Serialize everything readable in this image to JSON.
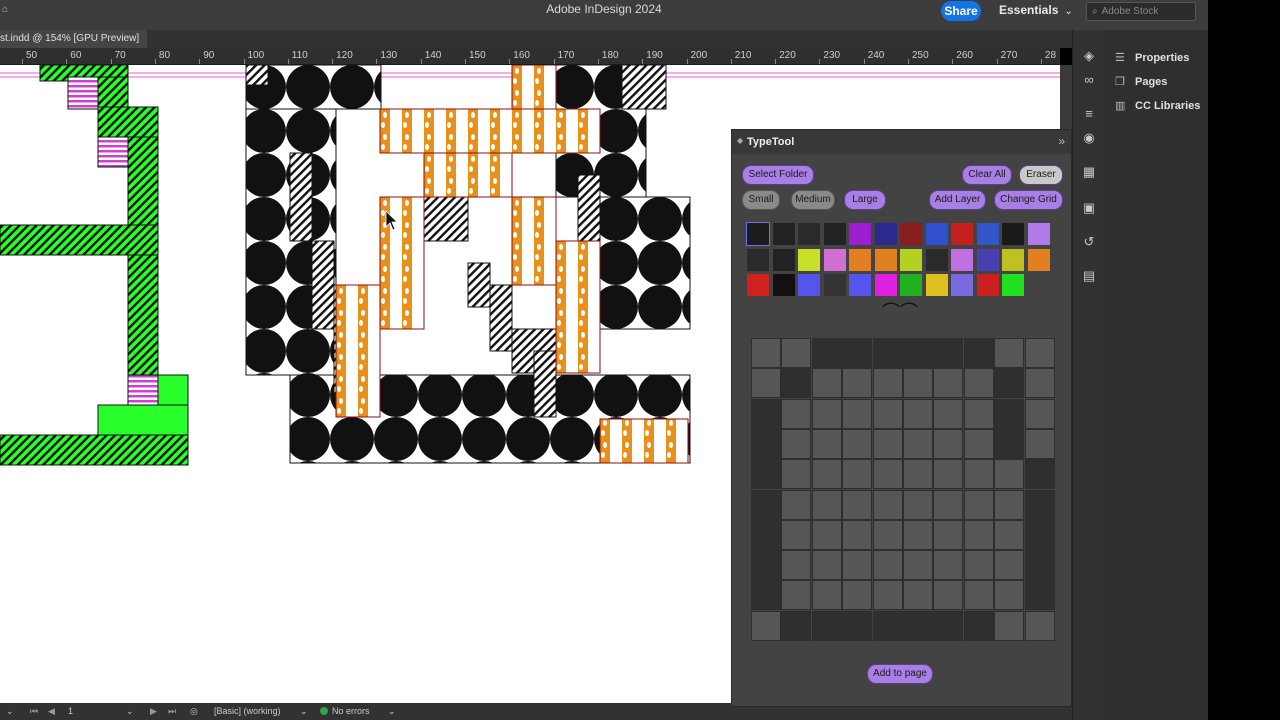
{
  "app": {
    "title": "Adobe InDesign 2024",
    "share_label": "Share",
    "workspace": "Essentials",
    "stock_placeholder": "Adobe Stock"
  },
  "document": {
    "tab_label": "st.indd @ 154% [GPU Preview]"
  },
  "ruler": {
    "labels": [
      "50",
      "60",
      "70",
      "80",
      "90",
      "100",
      "110",
      "120",
      "130",
      "140",
      "150",
      "160",
      "170",
      "180",
      "190",
      "200",
      "210",
      "220",
      "230",
      "240",
      "250",
      "260",
      "270",
      "28"
    ]
  },
  "status": {
    "page": "1",
    "style": "[Basic] (working)",
    "preflight": "No errors"
  },
  "right_panel": {
    "items": [
      "Properties",
      "Pages",
      "CC Libraries"
    ]
  },
  "typetool": {
    "title": "TypeTool",
    "buttons": {
      "select_folder": "Select Folder",
      "clear_all": "Clear All",
      "eraser": "Eraser",
      "small": "Small",
      "medium": "Medium",
      "large": "Large",
      "add_layer": "Add Layer",
      "change_grid": "Change Grid",
      "add_to_page": "Add to page"
    },
    "palette_colors": [
      "#1d1d1d",
      "#222222",
      "#2a2a2a",
      "#222222",
      "#9b1fd0",
      "#2b2b8f",
      "#8a1d1d",
      "#3050d0",
      "#c42020",
      "#3355cc",
      "#1a1a1a",
      "#b07ae8",
      "#2b2b2b",
      "#222222",
      "#c9e02a",
      "#d070d0",
      "#e08020",
      "#e08020",
      "#b5d020",
      "#2a2a2a",
      "#c070e0",
      "#4a3fb0",
      "#c0c020",
      "#e08020",
      "#d02020",
      "#111111",
      "#5555ee",
      "#333333",
      "#5555ee",
      "#e020e0",
      "#20b020",
      "#e0c020",
      "#7a6ae0",
      "#cc2020",
      "#20e020"
    ]
  },
  "colors": {
    "accent": "#a77fe5",
    "share": "#1473e6",
    "green": "#2bff2b",
    "orange": "#e8901a",
    "magenta": "#d040d0"
  }
}
